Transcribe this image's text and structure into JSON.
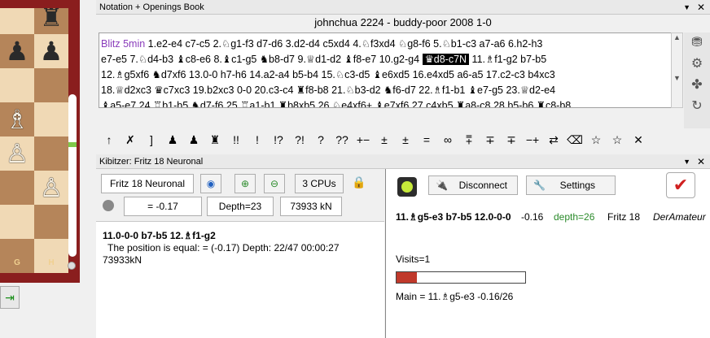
{
  "board": {
    "files": [
      "G",
      "H"
    ],
    "pieces": [
      {
        "r": 0,
        "c": 1,
        "g": "♜",
        "s": "b",
        "name": "black-rook"
      },
      {
        "r": 1,
        "c": 0,
        "g": "♟",
        "s": "b",
        "name": "black-pawn"
      },
      {
        "r": 1,
        "c": 1,
        "g": "♟",
        "s": "b",
        "name": "black-pawn"
      },
      {
        "r": 3,
        "c": 0,
        "g": "♗",
        "s": "w",
        "name": "white-bishop"
      },
      {
        "r": 4,
        "c": 0,
        "g": "♙",
        "s": "w",
        "name": "white-pawn"
      },
      {
        "r": 5,
        "c": 1,
        "g": "♙",
        "s": "w",
        "name": "white-pawn"
      }
    ]
  },
  "notation": {
    "title": "Notation + Openings Book",
    "header_line": "johnchua 2224 - buddy-poor 2008  1-0",
    "event": "Blitz 5min",
    "lines": [
      [
        {
          "t": "1.e2-e4  c7-c5  2.♘g1-f3  d7-d6  3.d2-d4  c5xd4  4.♘f3xd4  ♘g8-f6  5.♘b1-c3  a7-a6  6.h2-h3"
        }
      ],
      [
        {
          "t": "e7-e5  7.♘d4-b3  ♝c8-e6  8.♝c1-g5  ♞b8-d7  9.♕d1-d2  ♝f8-e7  10.g2-g4  "
        },
        {
          "t": "♛d8-c7N",
          "sel": true
        },
        {
          "t": "  11.♗f1-g2  b7-b5"
        }
      ],
      [
        {
          "t": "18.♕d2xc3  ♛c7xc3  19.b2xc3  0-0  20.c3-c4  ♜f8-b8  21.♘b3-d2  ♞f6-d7  22.♗f1-b1  ♝e7-g5  23.♕d2-e4"
        }
      ],
      [
        {
          "t": "♝a5-e7  24.♖b1-b5  ♞d7-f6  25.♖a1-b1  ♜b8xb5  26.♘e4xf6+  ♝e7xf6  27.c4xb5  ♜a8-c8  28.b5-b6  ♜c8-b8"
        }
      ]
    ],
    "line1_extra": "12.♗g5xf6  ♞d7xf6  13.0-0  h7-h6  14.a2-a4  b5-b4  15.♘c3-d5  ♝e6xd5  16.e4xd5  a6-a5  17.c2-c3  b4xc3",
    "annotations": [
      "↑",
      "✗",
      "]",
      "♟",
      "♟",
      "♜",
      "!!",
      "!",
      "!?",
      "?!",
      "?",
      "??",
      "+−",
      "±",
      "±",
      "=",
      "∞",
      "⩱",
      "∓",
      "∓",
      "−+",
      "⇄",
      "⌫",
      "☆",
      "☆",
      "✕"
    ]
  },
  "kibitzer": {
    "title": "Kibitzer: Fritz 18 Neuronal",
    "engine_name": "Fritz 18 Neuronal",
    "cpus": "3 CPUs",
    "eval": "= -0.17",
    "depth": "Depth=23",
    "speed": "73933 kN",
    "pv": "11.0-0-0  b7-b5  12.♗f1-g2",
    "assessment": "The position is equal: = (-0.17)  Depth: 22/47   00:00:27",
    "nodes": "73933kN",
    "disconnect": "Disconnect",
    "settings": "Settings",
    "remote_pv": "11.♗g5-e3  b7-b5  12.0-0-0",
    "remote_eval": "-0.16",
    "remote_depth": "depth=26",
    "remote_engine": "Fritz 18",
    "remote_user": "DerAmateur",
    "visits": "Visits=1",
    "visits_progress": 0.16,
    "main": "Main = 11.♗g5-e3    -0.16/26",
    "colors": {
      "depth": "#2a8a2a",
      "bar": "#c0392b"
    }
  }
}
